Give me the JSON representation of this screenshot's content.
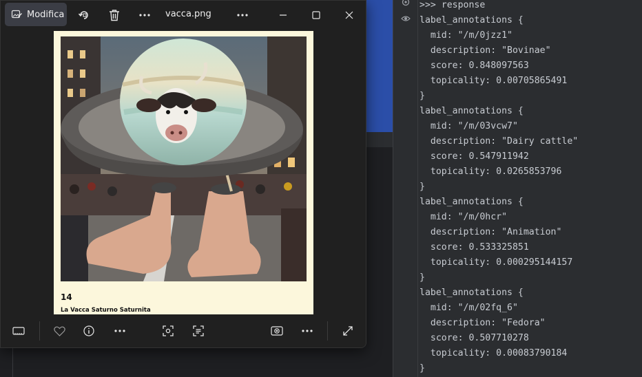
{
  "photo_viewer": {
    "edit_label": "Modifica",
    "file_name": "vacca.png",
    "card": {
      "number": "14",
      "caption": "La Vacca Saturno Saturnita"
    },
    "icons": {
      "edit": "edit-image-icon",
      "rotate": "rotate-icon",
      "delete": "trash-icon",
      "more": "more-icon",
      "minimize": "minimize-icon",
      "maximize": "maximize-icon",
      "close": "close-icon",
      "filmstrip": "filmstrip-icon",
      "favorite": "heart-icon",
      "info": "info-icon",
      "visual_search": "visual-search-icon",
      "extract_text": "extract-text-icon",
      "background": "background-icon",
      "fullscreen": "fullscreen-icon"
    }
  },
  "console": {
    "lines": [
      ">>> response",
      "label_annotations {",
      "  mid: \"/m/0jzz1\"",
      "  description: \"Bovinae\"",
      "  score: 0.848097563",
      "  topicality: 0.00705865491",
      "}",
      "label_annotations {",
      "  mid: \"/m/03vcw7\"",
      "  description: \"Dairy cattle\"",
      "  score: 0.547911942",
      "  topicality: 0.0265853796",
      "}",
      "label_annotations {",
      "  mid: \"/m/0hcr\"",
      "  description: \"Animation\"",
      "  score: 0.533325851",
      "  topicality: 0.000295144157",
      "}",
      "label_annotations {",
      "  mid: \"/m/02fq_6\"",
      "  description: \"Fedora\"",
      "  score: 0.507710278",
      "  topicality: 0.00083790184",
      "}"
    ],
    "icons": {
      "settings": "gear-icon",
      "view": "eye-icon"
    }
  },
  "colors": {
    "accent_blue": "#2b4ea8",
    "console_bg": "#2b2d30",
    "window_bg": "#202020",
    "card_bg": "#fcf7dc"
  }
}
